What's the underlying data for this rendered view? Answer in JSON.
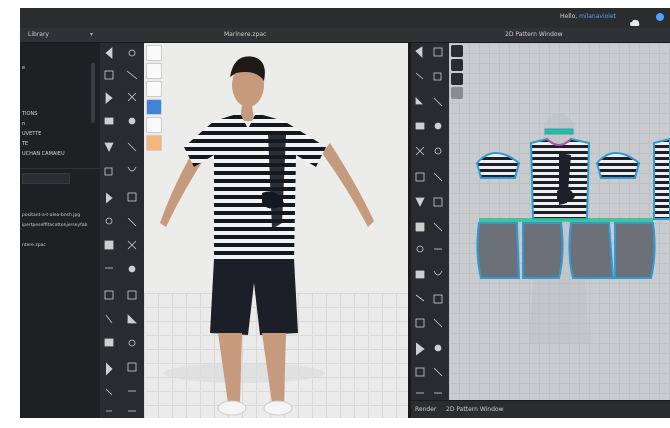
{
  "topbar": {
    "greeting_prefix": "Hello, ",
    "username": "milanaviolet"
  },
  "library": {
    "tab_label": "Library",
    "tree_items": [
      "e",
      "TIONS",
      "n",
      "UVETTE",
      "TE",
      "UCHAN CAMAIEU"
    ],
    "files": [
      "positant-a-t-alea-bnsh.jpg",
      "ipertpeseffitacottonjerseyfab",
      "ntere.zpac"
    ]
  },
  "viewport3d": {
    "title": "Marinere.zpac"
  },
  "viewport2d": {
    "title": "2D Pattern Window"
  },
  "statusbar": {
    "render_label": "Render",
    "window_label": "2D Pattern Window"
  },
  "colors": {
    "accent": "#4aa3ff",
    "seam_blue": "#2f9bd6",
    "seam_pink": "#d93c8d",
    "seam_green": "#28c08a",
    "panel_bg": "#222325"
  }
}
